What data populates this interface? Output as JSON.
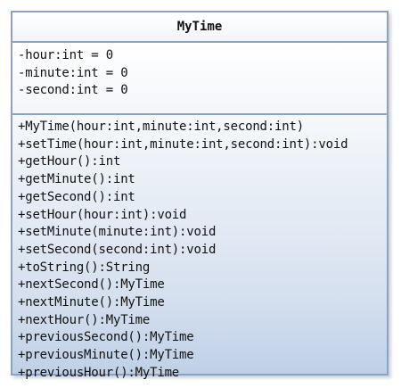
{
  "class_name": "MyTime",
  "attributes": [
    "-hour:int = 0",
    "-minute:int = 0",
    "-second:int = 0"
  ],
  "operations": [
    "+MyTime(hour:int,minute:int,second:int)",
    "+setTime(hour:int,minute:int,second:int):void",
    "+getHour():int",
    "+getMinute():int",
    "+getSecond():int",
    "+setHour(hour:int):void",
    "+setMinute(minute:int):void",
    "+setSecond(second:int):void",
    "+toString():String",
    "+nextSecond():MyTime",
    "+nextMinute():MyTime",
    "+nextHour():MyTime",
    "+previousSecond():MyTime",
    "+previousMinute():MyTime",
    "+previousHour():MyTime"
  ]
}
